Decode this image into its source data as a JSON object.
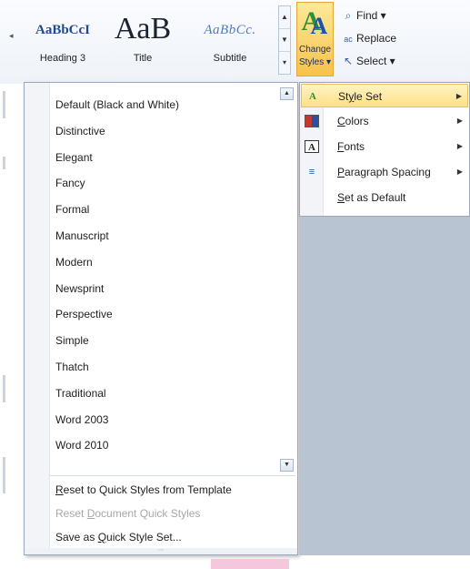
{
  "ribbon": {
    "styles_gallery": [
      {
        "preview": "AaBbCcI",
        "caption": "Heading 3"
      },
      {
        "preview": "AaB",
        "caption": "Title"
      },
      {
        "preview": "AaBbCc.",
        "caption": "Subtitle"
      }
    ],
    "change_styles": {
      "icon_text": "A",
      "label_line1": "Change",
      "label_line2": "Styles ▾"
    },
    "editing": [
      {
        "icon": "binoculars-icon",
        "glyph": "🔭",
        "label": "Find ▾"
      },
      {
        "icon": "replace-icon",
        "glyph": "ab",
        "label": "Replace"
      },
      {
        "icon": "select-cursor-icon",
        "glyph": "⇲",
        "label": "Select ▾"
      }
    ]
  },
  "style_sets": {
    "items": [
      "Default (Black and White)",
      "Distinctive",
      "Elegant",
      "Fancy",
      "Formal",
      "Manuscript",
      "Modern",
      "Newsprint",
      "Perspective",
      "Simple",
      "Thatch",
      "Traditional",
      "Word 2003",
      "Word 2010"
    ],
    "actions": [
      {
        "pre": "",
        "mnemonic": "R",
        "post": "eset to Quick Styles from Template",
        "disabled": false
      },
      {
        "pre": "Reset ",
        "mnemonic": "D",
        "post": "ocument Quick Styles",
        "disabled": true
      },
      {
        "pre": "Save as ",
        "mnemonic": "Q",
        "post": "uick Style Set...",
        "disabled": false
      }
    ]
  },
  "change_styles_menu": [
    {
      "pre": "St",
      "mnemonic": "y",
      "post": "le Set",
      "icon": "style-set-icon",
      "submenu": true,
      "active": true
    },
    {
      "pre": "",
      "mnemonic": "C",
      "post": "olors",
      "icon": "colors-icon",
      "submenu": true,
      "active": false
    },
    {
      "pre": "",
      "mnemonic": "F",
      "post": "onts",
      "icon": "fonts-icon",
      "submenu": true,
      "active": false
    },
    {
      "pre": "",
      "mnemonic": "P",
      "post": "aragraph Spacing",
      "icon": "paragraph-spacing-icon",
      "submenu": true,
      "active": false
    },
    {
      "pre": "",
      "mnemonic": "S",
      "post": "et as Default",
      "icon": "",
      "submenu": false,
      "active": false
    }
  ],
  "colors": {
    "accent_highlight": "#fde185",
    "menu_border": "#9aa8bd",
    "document_grey": "#b9c4d2",
    "disabled_text": "#a7a7a7"
  }
}
